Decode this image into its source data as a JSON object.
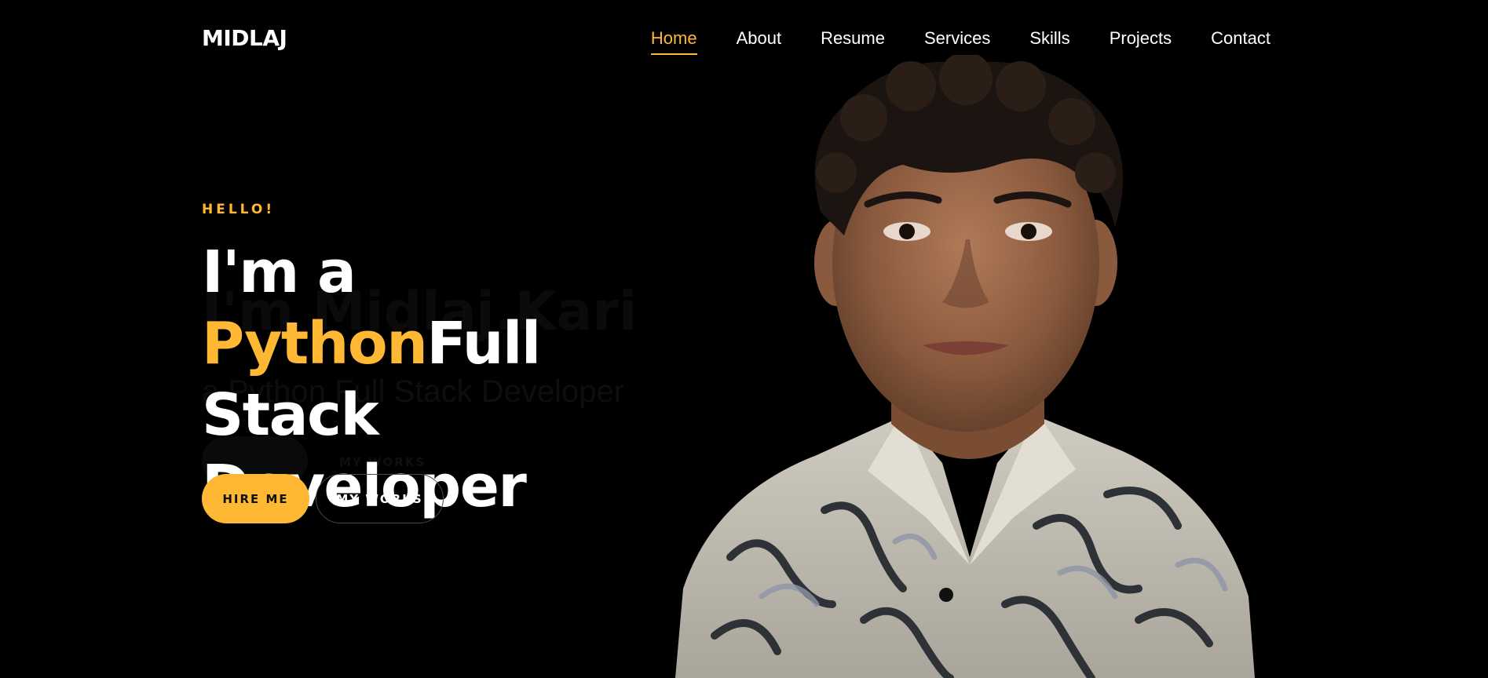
{
  "header": {
    "logo": "MIDLAJ",
    "nav": [
      {
        "label": "Home",
        "active": true
      },
      {
        "label": "About",
        "active": false
      },
      {
        "label": "Resume",
        "active": false
      },
      {
        "label": "Services",
        "active": false
      },
      {
        "label": "Skills",
        "active": false
      },
      {
        "label": "Projects",
        "active": false
      },
      {
        "label": "Contact",
        "active": false
      }
    ]
  },
  "hero": {
    "greeting": "HELLO!",
    "headline_prefix": "I'm a ",
    "headline_highlight": "Python",
    "headline_suffix": "Full Stack Developer",
    "ghost_title": "I'm Midlaj.Kari",
    "ghost_subtitle": "a Python Full Stack Developer",
    "ghost_button": "MY WORKS",
    "hire_button": "HIRE ME",
    "works_button": "MY WORKS"
  },
  "colors": {
    "background": "#000000",
    "accent": "#ffb833",
    "text": "#ffffff"
  }
}
